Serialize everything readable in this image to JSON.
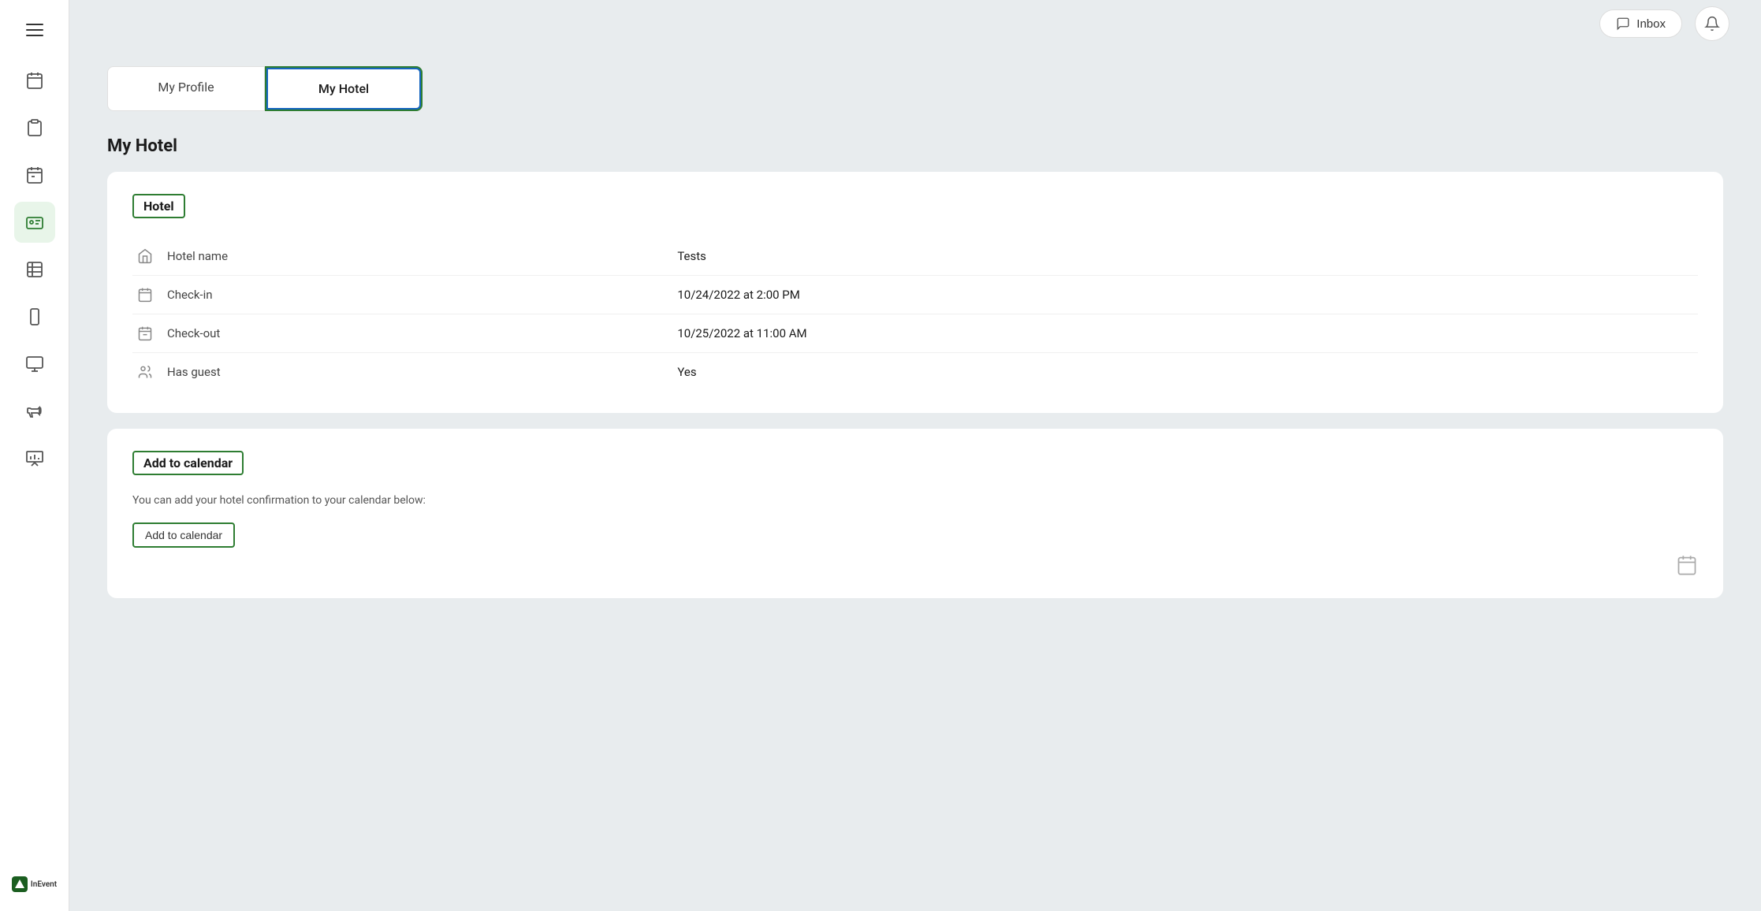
{
  "header": {
    "inbox_label": "Inbox",
    "notification_label": "Notifications"
  },
  "tabs": [
    {
      "id": "my-profile",
      "label": "My Profile",
      "active": false
    },
    {
      "id": "my-hotel",
      "label": "My Hotel",
      "active": true
    }
  ],
  "page": {
    "title": "My Hotel"
  },
  "hotel_card": {
    "section_label": "Hotel",
    "fields": [
      {
        "icon": "hotel",
        "label": "Hotel name",
        "value": "Tests"
      },
      {
        "icon": "checkin",
        "label": "Check-in",
        "value": "10/24/2022 at 2:00 PM"
      },
      {
        "icon": "checkout",
        "label": "Check-out",
        "value": "10/25/2022 at 11:00 AM"
      },
      {
        "icon": "guest",
        "label": "Has guest",
        "value": "Yes"
      }
    ]
  },
  "calendar_card": {
    "section_label": "Add to calendar",
    "description": "You can add your hotel confirmation to your calendar below:",
    "button_label": "Add to calendar"
  },
  "sidebar": {
    "items": [
      {
        "id": "calendar",
        "icon": "calendar"
      },
      {
        "id": "clipboard",
        "icon": "clipboard"
      },
      {
        "id": "calendar2",
        "icon": "calendar-alt"
      },
      {
        "id": "id-card",
        "icon": "id-card",
        "active": true
      },
      {
        "id": "table",
        "icon": "table"
      },
      {
        "id": "mobile",
        "icon": "mobile"
      },
      {
        "id": "monitor",
        "icon": "monitor"
      },
      {
        "id": "megaphone",
        "icon": "megaphone"
      },
      {
        "id": "presentation",
        "icon": "presentation"
      }
    ],
    "logo_text": "InEvent"
  }
}
